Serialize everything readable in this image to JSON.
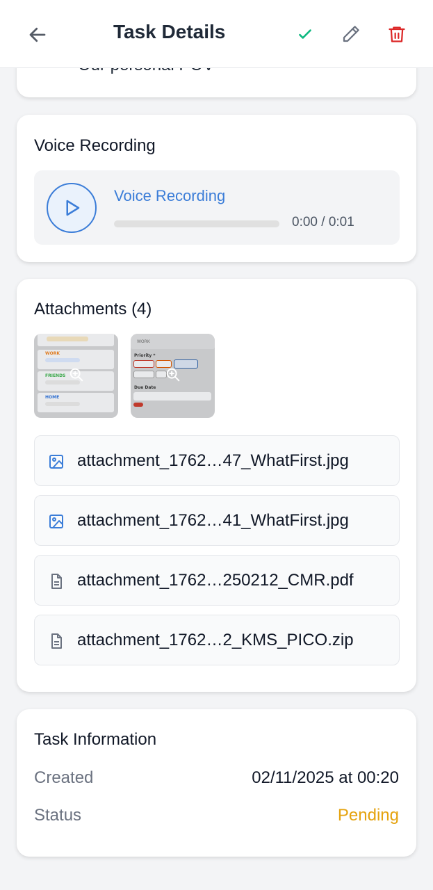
{
  "header": {
    "title": "Task Details",
    "back_icon": "arrow-left-icon",
    "actions": [
      {
        "icon": "check-icon",
        "color": "#10b981"
      },
      {
        "icon": "pencil-icon",
        "color": "#6b7280"
      },
      {
        "icon": "trash-icon",
        "color": "#dc2626"
      }
    ]
  },
  "description": {
    "visible_text": "Our personal POV"
  },
  "voice": {
    "section_title": "Voice Recording",
    "label": "Voice Recording",
    "time": "0:00 / 0:01",
    "progress": 0,
    "accent": "#3b7dd8"
  },
  "attachments": {
    "section_title": "Attachments (4)",
    "thumbnails": [
      {
        "icon": "zoom-in-icon"
      },
      {
        "icon": "zoom-in-icon"
      }
    ],
    "files": [
      {
        "name": "attachment_1762…47_WhatFirst.jpg",
        "icon": "image-icon"
      },
      {
        "name": "attachment_1762…41_WhatFirst.jpg",
        "icon": "image-icon"
      },
      {
        "name": "attachment_1762…250212_CMR.pdf",
        "icon": "document-icon"
      },
      {
        "name": "attachment_1762…2_KMS_PICO.zip",
        "icon": "document-icon"
      }
    ]
  },
  "info": {
    "section_title": "Task Information",
    "created_label": "Created",
    "created_value": "02/11/2025 at 00:20",
    "status_label": "Status",
    "status_value": "Pending",
    "status_color": "#e5a30f"
  }
}
